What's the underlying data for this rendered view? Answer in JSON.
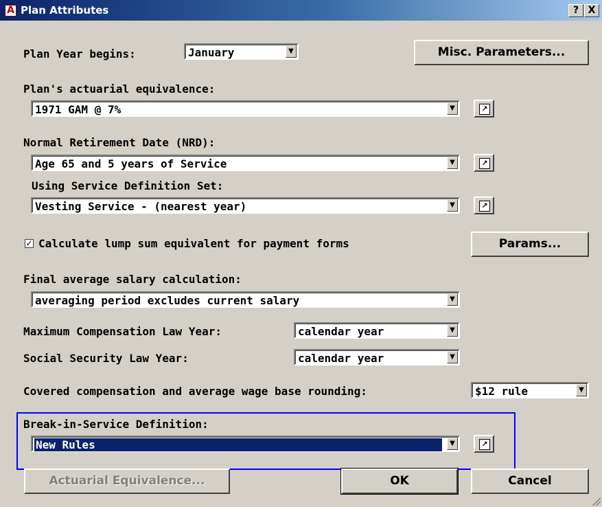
{
  "window": {
    "title": "Plan Attributes",
    "help_button": "?",
    "close_button": "X",
    "app_icon": "A"
  },
  "plan_year": {
    "label": "Plan Year begins:",
    "value": "January"
  },
  "misc_button": {
    "label": "Misc. Parameters..."
  },
  "actuarial_equivalence": {
    "label": "Plan's actuarial equivalence:",
    "value": "1971 GAM @ 7%"
  },
  "nrd": {
    "label": "Normal Retirement Date (NRD):",
    "value": "Age 65 and 5 years of Service"
  },
  "service_set": {
    "label": "Using Service Definition Set:",
    "value": "Vesting Service - (nearest year)"
  },
  "lump_sum": {
    "label": "Calculate lump sum equivalent for payment forms",
    "checked": true,
    "check_glyph": "✓"
  },
  "params_button": {
    "label": "Params..."
  },
  "final_avg": {
    "label": "Final average salary calculation:",
    "value": "averaging period excludes current salary"
  },
  "max_comp": {
    "label": "Maximum Compensation Law Year:",
    "value": "calendar year"
  },
  "ss_law": {
    "label": "Social Security Law Year:",
    "value": "calendar year"
  },
  "rounding": {
    "label": "Covered compensation and average wage base rounding:",
    "value": "$12 rule"
  },
  "bis": {
    "label": "Break-in-Service Definition:",
    "value": "New Rules"
  },
  "actuarial_button": {
    "label": "Actuarial Equivalence..."
  },
  "ok_button": {
    "label": "OK"
  },
  "cancel_button": {
    "label": "Cancel"
  },
  "icons": {
    "dropdown": "▼",
    "edit": "↗"
  },
  "colors": {
    "titlebar": "#0a246a",
    "selection": "#0a246a",
    "focus_box": "#0000ff",
    "face": "#d4d0c8"
  }
}
